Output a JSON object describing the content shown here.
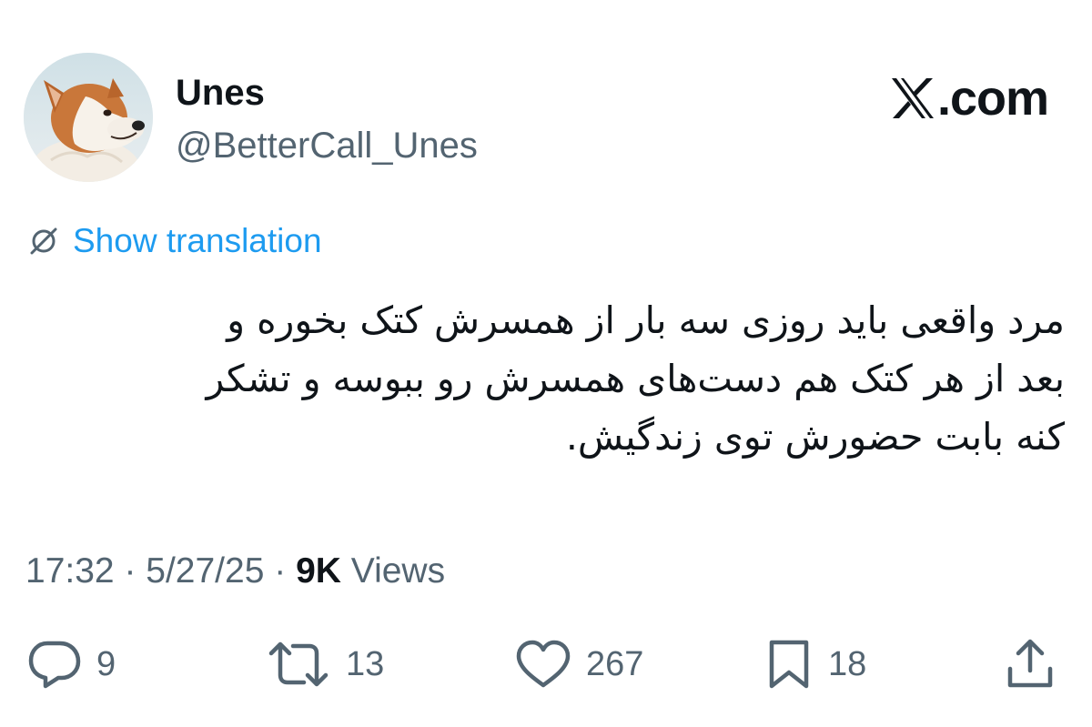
{
  "author": {
    "display_name": "Unes",
    "handle": "@BetterCall_Unes"
  },
  "brand": {
    "label": ".com",
    "icon": "x-logo-icon"
  },
  "translate": {
    "label": "Show translation",
    "icon": "globe-translate-icon"
  },
  "tweet": {
    "lines": [
      "مرد واقعی باید روزی سه بار از همسرش کتک بخوره و",
      "بعد از هر کتک هم دست‌های همسرش رو ببوسه و تشکر",
      "کنه بابت حضورش توی زندگیش."
    ]
  },
  "meta": {
    "time": "17:32",
    "separator": " · ",
    "date": "5/27/25",
    "views_count": "9K",
    "views_label": " Views"
  },
  "actions": {
    "reply": {
      "icon": "reply-icon",
      "count": "9"
    },
    "retweet": {
      "icon": "retweet-icon",
      "count": "13"
    },
    "like": {
      "icon": "heart-icon",
      "count": "267"
    },
    "bookmark": {
      "icon": "bookmark-icon",
      "count": "18"
    },
    "share": {
      "icon": "share-icon"
    }
  },
  "colors": {
    "text": "#0f1419",
    "secondary": "#536471",
    "link": "#1d9bf0",
    "background": "#ffffff"
  }
}
